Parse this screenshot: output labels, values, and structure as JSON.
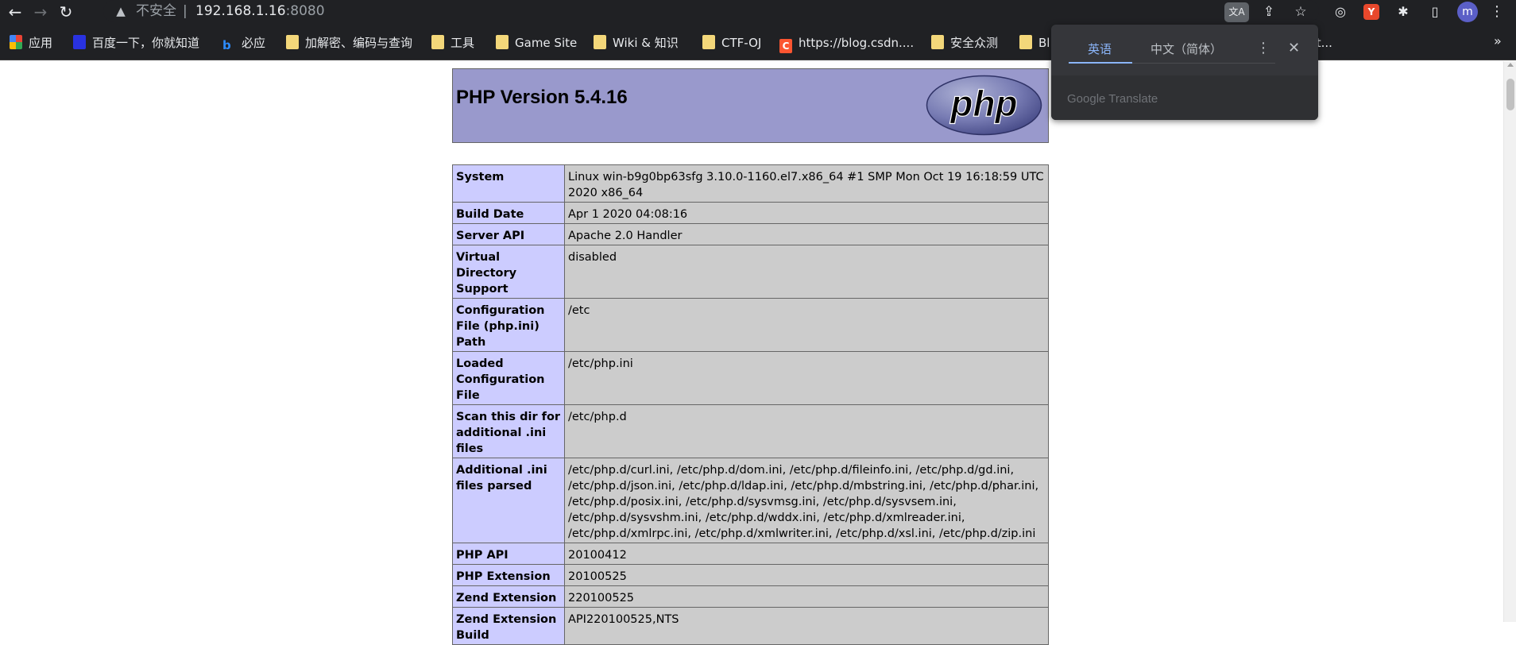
{
  "browser": {
    "security_label": "不安全",
    "separator": "|",
    "host": "192.168.1.16",
    "port": ":8080",
    "avatar_letter": "m",
    "ext_red_label": "Y",
    "translate_label": "文A"
  },
  "bookmarks": {
    "items": [
      {
        "label": "应用",
        "icon": "apps-icon"
      },
      {
        "label": "百度一下，你就知道",
        "icon": "baidu-icon"
      },
      {
        "label": "必应",
        "icon": "bing-icon"
      },
      {
        "label": "加解密、编码与查询",
        "icon": "folder-icon"
      },
      {
        "label": "工具",
        "icon": "folder-icon"
      },
      {
        "label": "Game Site",
        "icon": "folder-icon"
      },
      {
        "label": "Wiki & 知识",
        "icon": "folder-icon"
      },
      {
        "label": "CTF-OJ",
        "icon": "folder-icon"
      },
      {
        "label": "https://blog.csdn....",
        "icon": "csdn-icon"
      },
      {
        "label": "安全众测",
        "icon": "folder-icon"
      },
      {
        "label": "Bl",
        "icon": "folder-icon"
      },
      {
        "label": "ant...",
        "icon": "folder-icon"
      }
    ],
    "overflow": "»"
  },
  "translate_popup": {
    "tab_source": "英语",
    "tab_target": "中文（简体）",
    "brand": "Google Translate"
  },
  "phpinfo": {
    "title": "PHP Version 5.4.16",
    "logo_text": "php",
    "rows": [
      {
        "key": "System",
        "value": "Linux win-b9g0bp63sfg 3.10.0-1160.el7.x86_64 #1 SMP Mon Oct 19 16:18:59 UTC 2020 x86_64"
      },
      {
        "key": "Build Date",
        "value": "Apr 1 2020 04:08:16"
      },
      {
        "key": "Server API",
        "value": "Apache 2.0 Handler"
      },
      {
        "key": "Virtual Directory Support",
        "value": "disabled"
      },
      {
        "key": "Configuration File (php.ini) Path",
        "value": "/etc"
      },
      {
        "key": "Loaded Configuration File",
        "value": "/etc/php.ini"
      },
      {
        "key": "Scan this dir for additional .ini files",
        "value": "/etc/php.d"
      },
      {
        "key": "Additional .ini files parsed",
        "value": "/etc/php.d/curl.ini, /etc/php.d/dom.ini, /etc/php.d/fileinfo.ini, /etc/php.d/gd.ini, /etc/php.d/json.ini, /etc/php.d/ldap.ini, /etc/php.d/mbstring.ini, /etc/php.d/phar.ini, /etc/php.d/posix.ini, /etc/php.d/sysvmsg.ini, /etc/php.d/sysvsem.ini, /etc/php.d/sysvshm.ini, /etc/php.d/wddx.ini, /etc/php.d/xmlreader.ini, /etc/php.d/xmlrpc.ini, /etc/php.d/xmlwriter.ini, /etc/php.d/xsl.ini, /etc/php.d/zip.ini"
      },
      {
        "key": "PHP API",
        "value": "20100412"
      },
      {
        "key": "PHP Extension",
        "value": "20100525"
      },
      {
        "key": "Zend Extension",
        "value": "220100525"
      },
      {
        "key": "Zend Extension Build",
        "value": "API220100525,NTS"
      }
    ]
  },
  "colors": {
    "chrome_bg": "#202124",
    "php_header": "#9999cc",
    "key_cell": "#ccccff",
    "value_cell": "#cccccc",
    "translate_accent": "#8ab4f8"
  }
}
